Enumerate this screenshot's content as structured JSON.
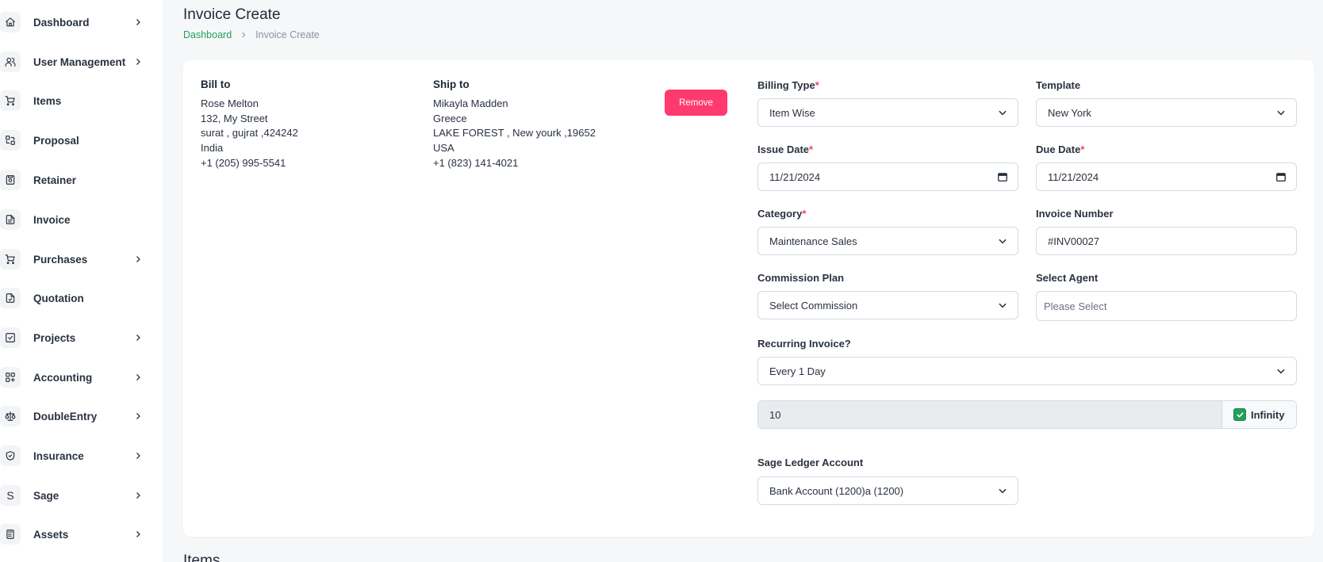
{
  "sidebar": {
    "items": [
      {
        "label": "Dashboard",
        "icon": "home-icon",
        "has_submenu": true
      },
      {
        "label": "User Management",
        "icon": "users-icon",
        "has_submenu": true
      },
      {
        "label": "Items",
        "icon": "cart-icon",
        "has_submenu": false
      },
      {
        "label": "Proposal",
        "icon": "swap-icon",
        "has_submenu": false
      },
      {
        "label": "Retainer",
        "icon": "save-icon",
        "has_submenu": false
      },
      {
        "label": "Invoice",
        "icon": "file-invoice-icon",
        "has_submenu": false
      },
      {
        "label": "Purchases",
        "icon": "cart-icon",
        "has_submenu": true
      },
      {
        "label": "Quotation",
        "icon": "file-dollar-icon",
        "has_submenu": false
      },
      {
        "label": "Projects",
        "icon": "check-square-icon",
        "has_submenu": true
      },
      {
        "label": "Accounting",
        "icon": "layout-grid-icon",
        "has_submenu": true
      },
      {
        "label": "DoubleEntry",
        "icon": "scale-icon",
        "has_submenu": true
      },
      {
        "label": "Insurance",
        "icon": "shield-icon",
        "has_submenu": true
      },
      {
        "label": "Sage",
        "icon": "letter-s-icon",
        "has_submenu": true
      },
      {
        "label": "Assets",
        "icon": "calculator-icon",
        "has_submenu": true
      }
    ],
    "sage_glyph": "S"
  },
  "header": {
    "title": "Invoice Create",
    "breadcrumb": {
      "home": "Dashboard",
      "current": "Invoice Create"
    }
  },
  "bill_to": {
    "title": "Bill to",
    "name": "Rose Melton",
    "street": "132, My Street",
    "city_line": "surat , gujrat ,424242",
    "country": "India",
    "phone": "+1 (205) 995-5541"
  },
  "ship_to": {
    "title": "Ship to",
    "name": "Mikayla Madden",
    "street": "Greece",
    "city_line": "LAKE FOREST , New yourk ,19652",
    "country": "USA",
    "phone": "+1 (823) 141-4021"
  },
  "remove_label": "Remove",
  "form": {
    "billing_type": {
      "label": "Billing Type",
      "required": "*",
      "value": "Item Wise"
    },
    "template": {
      "label": "Template",
      "value": "New York"
    },
    "issue_date": {
      "label": "Issue Date",
      "required": "*",
      "value": "11/21/2024"
    },
    "due_date": {
      "label": "Due Date",
      "required": "*",
      "value": "11/21/2024"
    },
    "category": {
      "label": "Category",
      "required": "*",
      "value": "Maintenance Sales"
    },
    "invoice_number": {
      "label": "Invoice Number",
      "value": "#INV00027"
    },
    "commission_plan": {
      "label": "Commission Plan",
      "value": "Select Commission"
    },
    "select_agent": {
      "label": "Select Agent",
      "placeholder": "Please Select"
    },
    "recurring": {
      "label": "Recurring Invoice?",
      "value": "Every 1 Day"
    },
    "recurring_count": {
      "value": "10",
      "infinity_label": "Infinity",
      "infinity_checked": true
    },
    "sage_ledger": {
      "label": "Sage Ledger Account",
      "value": "Bank Account (1200)a (1200)"
    }
  },
  "items_heading": "Items",
  "colors": {
    "accent": "#22a05a",
    "danger": "#ff3a6e",
    "text": "#293240"
  }
}
